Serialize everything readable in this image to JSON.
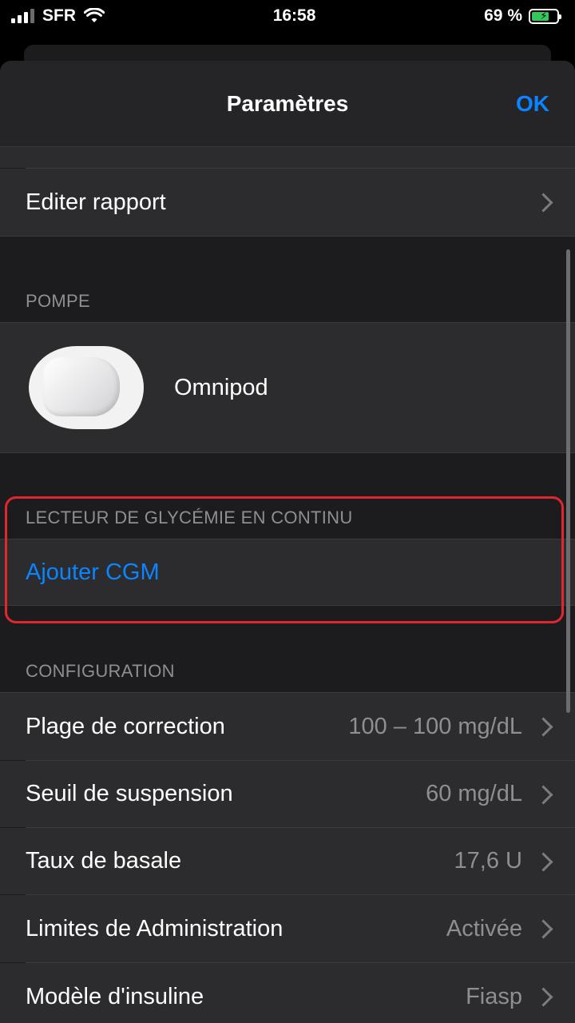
{
  "status_bar": {
    "carrier": "SFR",
    "time": "16:58",
    "battery_percent": "69 %",
    "battery_level": 0.69
  },
  "nav": {
    "title": "Paramètres",
    "ok_label": "OK"
  },
  "rows_top": [
    {
      "label": "Editer rapport"
    }
  ],
  "pump_section": {
    "header": "POMPE",
    "device_name": "Omnipod"
  },
  "cgm_section": {
    "header": "LECTEUR DE GLYCÉMIE EN CONTINU",
    "add_label": "Ajouter CGM"
  },
  "config_section": {
    "header": "CONFIGURATION",
    "items": [
      {
        "label": "Plage de correction",
        "value": "100 – 100 mg/dL"
      },
      {
        "label": "Seuil de suspension",
        "value": "60 mg/dL"
      },
      {
        "label": "Taux de basale",
        "value": "17,6 U"
      },
      {
        "label": "Limites de Administration",
        "value": "Activée"
      },
      {
        "label": "Modèle d'insuline",
        "value": "Fiasp"
      }
    ]
  },
  "colors": {
    "accent": "#0a84ff",
    "highlight_border": "#e0262f",
    "cell_bg": "#2c2c2e",
    "secondary_text": "#8e8e93"
  }
}
